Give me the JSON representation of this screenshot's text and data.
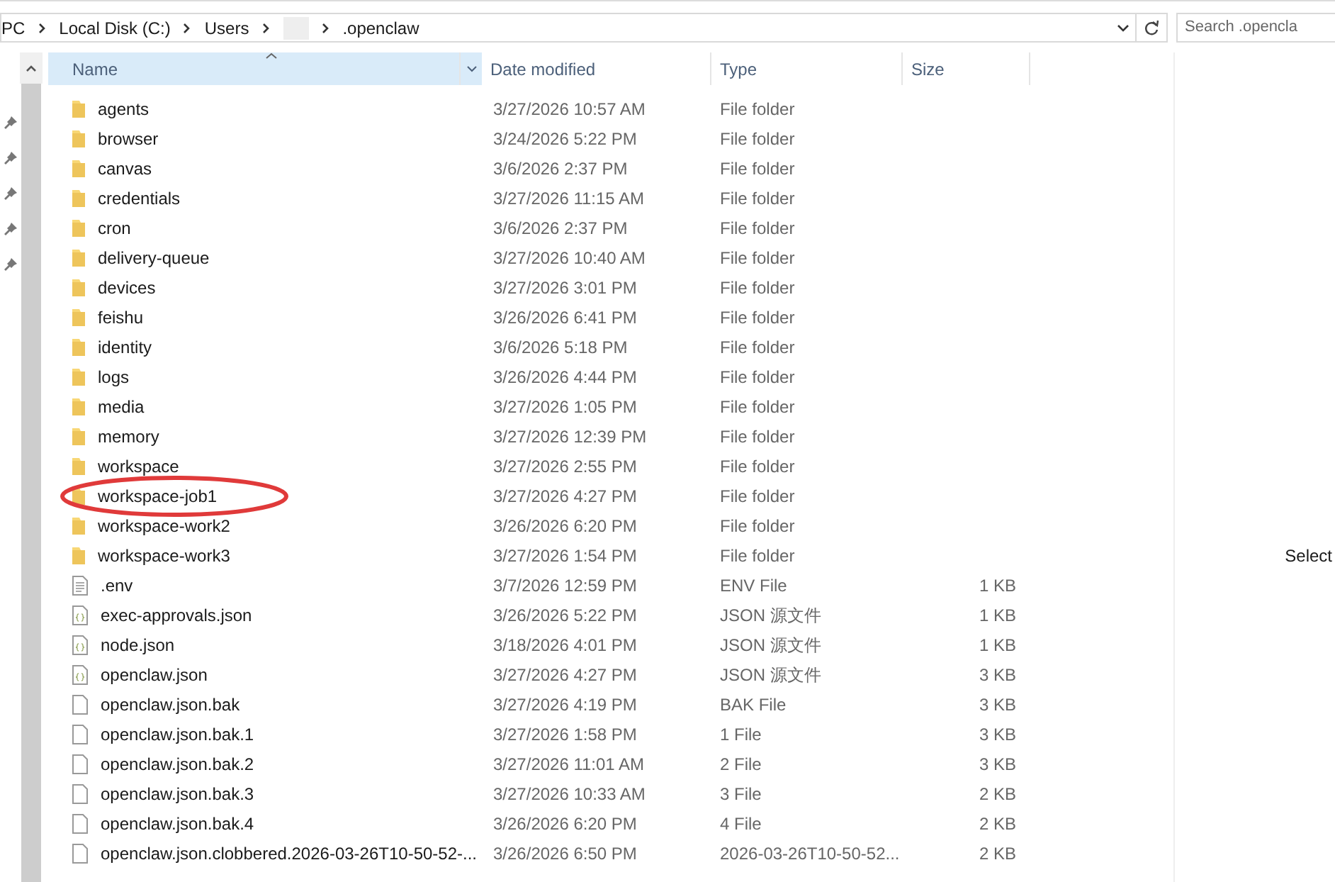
{
  "address_bar": {
    "crumbs": [
      {
        "kind": "text",
        "label": "PC"
      },
      {
        "kind": "text",
        "label": "Local Disk (C:)"
      },
      {
        "kind": "text",
        "label": "Users"
      },
      {
        "kind": "blurred"
      },
      {
        "kind": "text",
        "label": ".openclaw"
      }
    ]
  },
  "search": {
    "placeholder": "Search .opencla"
  },
  "columns": [
    {
      "label": "Name",
      "sorted": true
    },
    {
      "label": "Date modified",
      "sorted": false
    },
    {
      "label": "Type",
      "sorted": false
    },
    {
      "label": "Size",
      "sorted": false
    }
  ],
  "rows": [
    {
      "kind": "folder",
      "name": "agents",
      "date": "3/27/2026 10:57 AM",
      "type": "File folder",
      "circled": false
    },
    {
      "kind": "folder",
      "name": "browser",
      "date": "3/24/2026 5:22 PM",
      "type": "File folder",
      "circled": false
    },
    {
      "kind": "folder",
      "name": "canvas",
      "date": "3/6/2026 2:37 PM",
      "type": "File folder",
      "circled": false
    },
    {
      "kind": "folder",
      "name": "credentials",
      "date": "3/27/2026 11:15 AM",
      "type": "File folder",
      "circled": false
    },
    {
      "kind": "folder",
      "name": "cron",
      "date": "3/6/2026 2:37 PM",
      "type": "File folder",
      "circled": false
    },
    {
      "kind": "folder",
      "name": "delivery-queue",
      "date": "3/27/2026 10:40 AM",
      "type": "File folder",
      "circled": false
    },
    {
      "kind": "folder",
      "name": "devices",
      "date": "3/27/2026 3:01 PM",
      "type": "File folder",
      "circled": false
    },
    {
      "kind": "folder",
      "name": "feishu",
      "date": "3/26/2026 6:41 PM",
      "type": "File folder",
      "circled": false
    },
    {
      "kind": "folder",
      "name": "identity",
      "date": "3/6/2026 5:18 PM",
      "type": "File folder",
      "circled": false
    },
    {
      "kind": "folder",
      "name": "logs",
      "date": "3/26/2026 4:44 PM",
      "type": "File folder",
      "circled": false
    },
    {
      "kind": "folder",
      "name": "media",
      "date": "3/27/2026 1:05 PM",
      "type": "File folder",
      "circled": false
    },
    {
      "kind": "folder",
      "name": "memory",
      "date": "3/27/2026 12:39 PM",
      "type": "File folder",
      "circled": false
    },
    {
      "kind": "folder",
      "name": "workspace",
      "date": "3/27/2026 2:55 PM",
      "type": "File folder",
      "circled": false
    },
    {
      "kind": "folder",
      "name": "workspace-job1",
      "date": "3/27/2026 4:27 PM",
      "type": "File folder",
      "circled": true
    },
    {
      "kind": "folder",
      "name": "workspace-work2",
      "date": "3/26/2026 6:20 PM",
      "type": "File folder",
      "circled": false
    },
    {
      "kind": "folder",
      "name": "workspace-work3",
      "date": "3/27/2026 1:54 PM",
      "type": "File folder",
      "circled": false
    },
    {
      "kind": "text",
      "name": ".env",
      "date": "3/7/2026 12:59 PM",
      "type": "ENV File",
      "size": "1 KB",
      "circled": false
    },
    {
      "kind": "json",
      "name": "exec-approvals.json",
      "date": "3/26/2026 5:22 PM",
      "type": "JSON 源文件",
      "size": "1 KB",
      "circled": false
    },
    {
      "kind": "json",
      "name": "node.json",
      "date": "3/18/2026 4:01 PM",
      "type": "JSON 源文件",
      "size": "1 KB",
      "circled": false
    },
    {
      "kind": "json",
      "name": "openclaw.json",
      "date": "3/27/2026 4:27 PM",
      "type": "JSON 源文件",
      "size": "3 KB",
      "circled": false
    },
    {
      "kind": "file",
      "name": "openclaw.json.bak",
      "date": "3/27/2026 4:19 PM",
      "type": "BAK File",
      "size": "3 KB",
      "circled": false
    },
    {
      "kind": "file",
      "name": "openclaw.json.bak.1",
      "date": "3/27/2026 1:58 PM",
      "type": "1 File",
      "size": "3 KB",
      "circled": false
    },
    {
      "kind": "file",
      "name": "openclaw.json.bak.2",
      "date": "3/27/2026 11:01 AM",
      "type": "2 File",
      "size": "3 KB",
      "circled": false
    },
    {
      "kind": "file",
      "name": "openclaw.json.bak.3",
      "date": "3/27/2026 10:33 AM",
      "type": "3 File",
      "size": "2 KB",
      "circled": false
    },
    {
      "kind": "file",
      "name": "openclaw.json.bak.4",
      "date": "3/26/2026 6:20 PM",
      "type": "4 File",
      "size": "2 KB",
      "circled": false
    },
    {
      "kind": "file",
      "name": "openclaw.json.clobbered.2026-03-26T10-50-52-...",
      "date": "3/26/2026 6:50 PM",
      "type": "2026-03-26T10-50-52...",
      "size": "2 KB",
      "circled": false
    }
  ],
  "preview_pane": {
    "message": "Select"
  }
}
